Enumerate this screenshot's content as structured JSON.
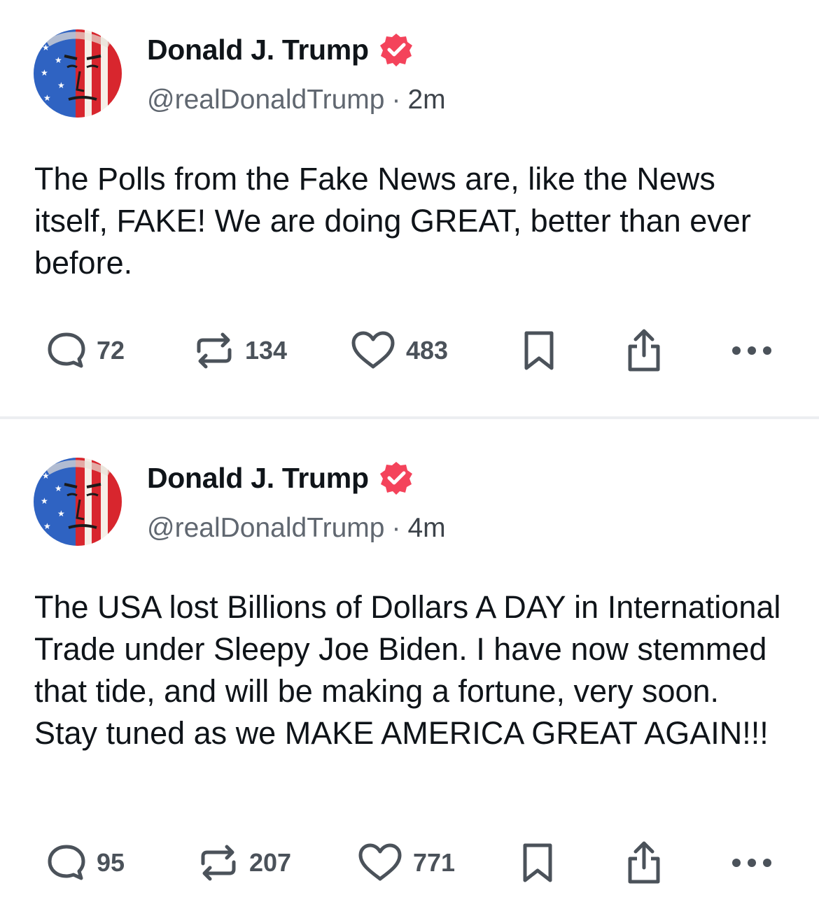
{
  "colors": {
    "verified": "#f4435b",
    "icon": "#4b525a",
    "handle": "#606770",
    "text": "#0f1419",
    "divider": "#eceef1"
  },
  "posts": [
    {
      "author": {
        "display_name": "Donald J. Trump",
        "handle": "@realDonaldTrump",
        "verified_icon": "verified-badge-icon"
      },
      "separator": "·",
      "time": "2m",
      "text": "The Polls from the Fake News are, like the News itself, FAKE! We are doing GREAT, better than ever before.",
      "actions": {
        "replies": "72",
        "reposts": "134",
        "likes": "483"
      }
    },
    {
      "author": {
        "display_name": "Donald J. Trump",
        "handle": "@realDonaldTrump",
        "verified_icon": "verified-badge-icon"
      },
      "separator": "·",
      "time": "4m",
      "text": "The USA lost Billions of Dollars A DAY in International Trade under Sleepy Joe Biden. I have now stemmed that tide, and will be making a fortune, very soon. Stay tuned as we MAKE AMERICA GREAT AGAIN!!!",
      "actions": {
        "replies": "95",
        "reposts": "207",
        "likes": "771"
      }
    }
  ]
}
